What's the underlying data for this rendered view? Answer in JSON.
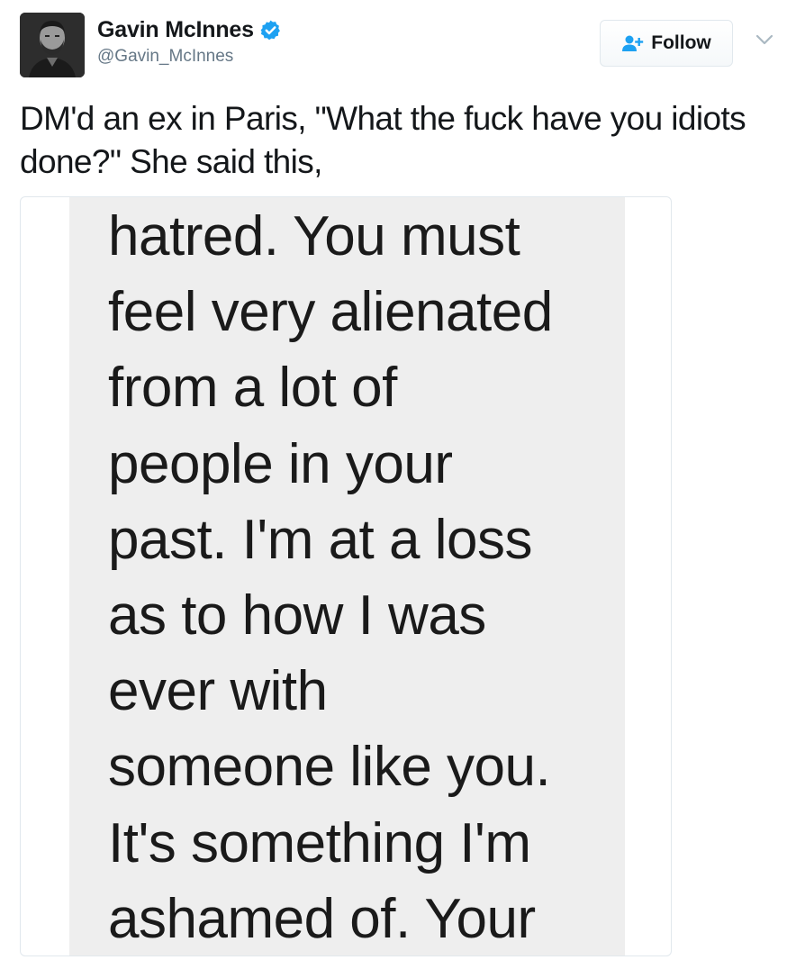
{
  "tweet": {
    "author": {
      "display_name": "Gavin McInnes",
      "handle": "@Gavin_McInnes",
      "verified": true
    },
    "follow_label": "Follow",
    "text": "DM'd an ex in Paris, \"What the fuck have you idiots done?\" She said this,",
    "media": {
      "message_lines": [
        "hatred. You must",
        "feel very alienated",
        "from a lot of",
        "people in your",
        "past. I'm at a loss",
        "as to how I was",
        "ever with",
        "someone like you.",
        "It's something I'm",
        "ashamed of. Your"
      ]
    }
  },
  "colors": {
    "verified_blue": "#1da1f2",
    "handle_gray": "#657786",
    "border": "#e1e8ed",
    "screenshot_bg": "#eeeeee"
  },
  "icons": {
    "avatar": "avatar",
    "verified": "verified-badge-icon",
    "follow": "follow-user-icon",
    "menu": "chevron-down-icon"
  }
}
